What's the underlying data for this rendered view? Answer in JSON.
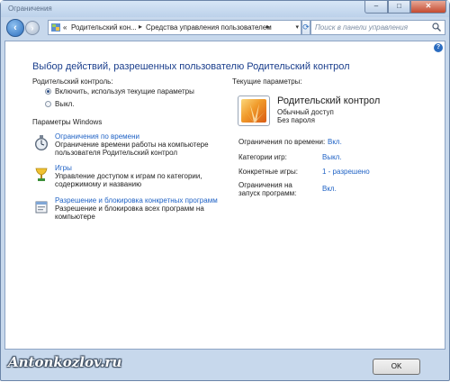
{
  "window": {
    "title": "Ограничения"
  },
  "titlebar_buttons": {
    "minimize": "–",
    "maximize": "□",
    "close": "✕"
  },
  "address": {
    "crumbs": [
      "«",
      "Родительский кон...",
      "Средства управления пользователем"
    ]
  },
  "search": {
    "placeholder": "Поиск в панели управления"
  },
  "content": {
    "heading": "Выбор действий, разрешенных пользователю Родительский контрол",
    "parental_control_label": "Родительский контроль:",
    "radio_on": "Включить, используя текущие параметры",
    "radio_off": "Выкл.",
    "radio_selected": "on",
    "windows_settings_label": "Параметры Windows",
    "items": [
      {
        "title": "Ограничения по времени",
        "desc1": "Ограничение времени работы на компьютере",
        "desc2": "пользователя Родительский контрол"
      },
      {
        "title": "Игры",
        "desc1": "Управление доступом к играм по категории,",
        "desc2": "содержимому и названию"
      },
      {
        "title": "Разрешение и блокировка конкретных программ",
        "desc1": "Разрешение и блокировка всех программ на",
        "desc2": "компьютере"
      }
    ],
    "current_settings_label": "Текущие параметры:",
    "user": {
      "name": "Родительский контрол",
      "access": "Обычный доступ",
      "password": "Без пароля"
    },
    "settings": [
      {
        "label": "Ограничения по времени:",
        "value": "Вкл."
      },
      {
        "label": "Категории игр:",
        "value": "Выкл."
      },
      {
        "label": "Конкретные игры:",
        "value": "1 - разрешено"
      },
      {
        "label1": "Ограничения на",
        "label2": "запуск программ:",
        "value": "Вкл."
      }
    ]
  },
  "footer": {
    "ok": "OK",
    "watermark": "Antonkozlov.ru"
  },
  "colors": {
    "link": "#1f62c5",
    "heading": "#1a3e8c",
    "frame": "#c7d8ec"
  }
}
